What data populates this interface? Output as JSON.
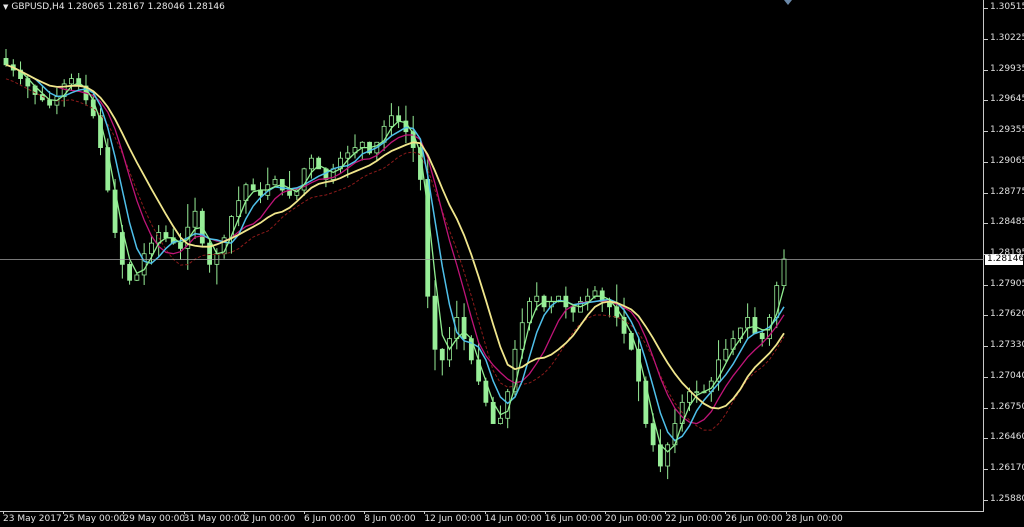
{
  "header": {
    "menu_icon": "triangle-down-icon",
    "symbol": "GBPUSD,H4",
    "ohlc": "1.28065 1.28167 1.28046 1.28146"
  },
  "price_axis": {
    "labels": [
      "1.30515",
      "1.30225",
      "1.29935",
      "1.29645",
      "1.29355",
      "1.29065",
      "1.28775",
      "1.28485",
      "1.28195",
      "1.27905",
      "1.27620",
      "1.27330",
      "1.27040",
      "1.26750",
      "1.26460",
      "1.26170",
      "1.25880"
    ],
    "current_price": "1.28146"
  },
  "time_axis": {
    "labels": [
      "23 May 2017",
      "25 May 00:00",
      "29 May 00:00",
      "31 May 00:00",
      "2 Jun 00:00",
      "6 Jun 00:00",
      "8 Jun 00:00",
      "12 Jun 00:00",
      "14 Jun 00:00",
      "16 Jun 00:00",
      "20 Jun 00:00",
      "22 Jun 00:00",
      "26 Jun 00:00",
      "28 Jun 00:00"
    ]
  },
  "colors": {
    "background": "#000000",
    "candle": "#98ee98",
    "ma_fast": "#90ee90",
    "ma_cyan": "#4fc0ea",
    "ma_magenta": "#c01478",
    "ma_slow": "#f0e68c",
    "ma_dashed": "#8b1a1a",
    "current_price_line": "#a0a0a0"
  },
  "chart_data": {
    "type": "candlestick",
    "symbol": "GBPUSD",
    "timeframe": "H4",
    "ylim": [
      1.2588,
      1.30515
    ],
    "last_close": 1.28146,
    "series": [
      {
        "name": "close",
        "values": [
          1.2998,
          1.2993,
          1.2985,
          1.2978,
          1.297,
          1.2965,
          1.296,
          1.2968,
          1.298,
          1.2985,
          1.2978,
          1.2965,
          1.295,
          1.292,
          1.288,
          1.284,
          1.281,
          1.2795,
          1.28,
          1.282,
          1.283,
          1.284,
          1.2835,
          1.283,
          1.2825,
          1.2845,
          1.286,
          1.283,
          1.281,
          1.282,
          1.2835,
          1.2855,
          1.287,
          1.2885,
          1.288,
          1.2875,
          1.2885,
          1.289,
          1.288,
          1.2875,
          1.288,
          1.29,
          1.291,
          1.29,
          1.289,
          1.29,
          1.291,
          1.2915,
          1.292,
          1.2925,
          1.2915,
          1.2925,
          1.294,
          1.295,
          1.2945,
          1.2935,
          1.292,
          1.289,
          1.278,
          1.273,
          1.272,
          1.274,
          1.276,
          1.274,
          1.272,
          1.27,
          1.268,
          1.266,
          1.2665,
          1.269,
          1.273,
          1.2755,
          1.2775,
          1.278,
          1.277,
          1.2775,
          1.278,
          1.277,
          1.2765,
          1.2775,
          1.278,
          1.2785,
          1.2775,
          1.277,
          1.276,
          1.2745,
          1.273,
          1.27,
          1.266,
          1.264,
          1.262,
          1.264,
          1.266,
          1.268,
          1.269,
          1.269,
          1.269,
          1.27,
          1.272,
          1.273,
          1.274,
          1.275,
          1.276,
          1.2745,
          1.274,
          1.276,
          1.279,
          1.2815
        ]
      }
    ]
  }
}
